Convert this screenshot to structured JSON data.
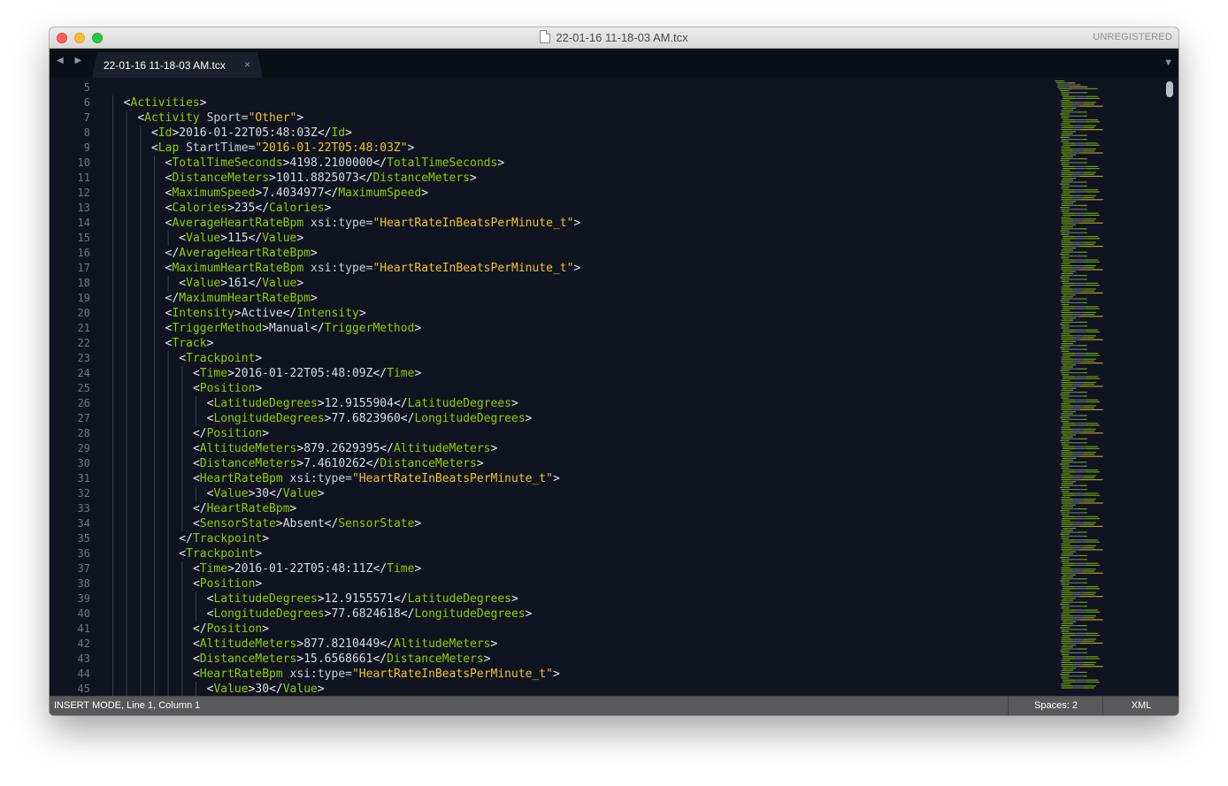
{
  "window": {
    "title": "22-01-16 11-18-03 AM.tcx",
    "unregistered": "UNREGISTERED"
  },
  "tabs": [
    {
      "label": "22-01-16 11-18-03 AM.tcx",
      "close": "×",
      "active": true
    }
  ],
  "navigation": {
    "arrows": "◀ ▶",
    "dropdown": "▼"
  },
  "editor": {
    "first_line_number": 5,
    "lines": [
      [],
      [
        [
          "p",
          "<"
        ],
        [
          "t",
          "Activities"
        ],
        [
          "p",
          ">"
        ]
      ],
      [
        [
          "p",
          "<"
        ],
        [
          "t",
          "Activity"
        ],
        [
          "a",
          " Sport="
        ],
        [
          "s",
          "\"Other\""
        ],
        [
          "p",
          ">"
        ]
      ],
      [
        [
          "p",
          "<"
        ],
        [
          "t",
          "Id"
        ],
        [
          "p",
          ">"
        ],
        [
          "x",
          "2016-01-22T05:48:03Z"
        ],
        [
          "p",
          "</"
        ],
        [
          "t",
          "Id"
        ],
        [
          "p",
          ">"
        ]
      ],
      [
        [
          "p",
          "<"
        ],
        [
          "t",
          "Lap"
        ],
        [
          "a",
          " StartTime="
        ],
        [
          "s",
          "\"2016-01-22T05:48:03Z\""
        ],
        [
          "p",
          ">"
        ]
      ],
      [
        [
          "p",
          "<"
        ],
        [
          "t",
          "TotalTimeSeconds"
        ],
        [
          "p",
          ">"
        ],
        [
          "x",
          "4198.2100000"
        ],
        [
          "p",
          "</"
        ],
        [
          "t",
          "TotalTimeSeconds"
        ],
        [
          "p",
          ">"
        ]
      ],
      [
        [
          "p",
          "<"
        ],
        [
          "t",
          "DistanceMeters"
        ],
        [
          "p",
          ">"
        ],
        [
          "x",
          "1011.8825073"
        ],
        [
          "p",
          "</"
        ],
        [
          "t",
          "DistanceMeters"
        ],
        [
          "p",
          ">"
        ]
      ],
      [
        [
          "p",
          "<"
        ],
        [
          "t",
          "MaximumSpeed"
        ],
        [
          "p",
          ">"
        ],
        [
          "x",
          "7.4034977"
        ],
        [
          "p",
          "</"
        ],
        [
          "t",
          "MaximumSpeed"
        ],
        [
          "p",
          ">"
        ]
      ],
      [
        [
          "p",
          "<"
        ],
        [
          "t",
          "Calories"
        ],
        [
          "p",
          ">"
        ],
        [
          "x",
          "235"
        ],
        [
          "p",
          "</"
        ],
        [
          "t",
          "Calories"
        ],
        [
          "p",
          ">"
        ]
      ],
      [
        [
          "p",
          "<"
        ],
        [
          "t",
          "AverageHeartRateBpm"
        ],
        [
          "a",
          " xsi:type="
        ],
        [
          "s",
          "\"HeartRateInBeatsPerMinute_t\""
        ],
        [
          "p",
          ">"
        ]
      ],
      [
        [
          "p",
          "<"
        ],
        [
          "t",
          "Value"
        ],
        [
          "p",
          ">"
        ],
        [
          "x",
          "115"
        ],
        [
          "p",
          "</"
        ],
        [
          "t",
          "Value"
        ],
        [
          "p",
          ">"
        ]
      ],
      [
        [
          "p",
          "</"
        ],
        [
          "t",
          "AverageHeartRateBpm"
        ],
        [
          "p",
          ">"
        ]
      ],
      [
        [
          "p",
          "<"
        ],
        [
          "t",
          "MaximumHeartRateBpm"
        ],
        [
          "a",
          " xsi:type="
        ],
        [
          "s",
          "\"HeartRateInBeatsPerMinute_t\""
        ],
        [
          "p",
          ">"
        ]
      ],
      [
        [
          "p",
          "<"
        ],
        [
          "t",
          "Value"
        ],
        [
          "p",
          ">"
        ],
        [
          "x",
          "161"
        ],
        [
          "p",
          "</"
        ],
        [
          "t",
          "Value"
        ],
        [
          "p",
          ">"
        ]
      ],
      [
        [
          "p",
          "</"
        ],
        [
          "t",
          "MaximumHeartRateBpm"
        ],
        [
          "p",
          ">"
        ]
      ],
      [
        [
          "p",
          "<"
        ],
        [
          "t",
          "Intensity"
        ],
        [
          "p",
          ">"
        ],
        [
          "x",
          "Active"
        ],
        [
          "p",
          "</"
        ],
        [
          "t",
          "Intensity"
        ],
        [
          "p",
          ">"
        ]
      ],
      [
        [
          "p",
          "<"
        ],
        [
          "t",
          "TriggerMethod"
        ],
        [
          "p",
          ">"
        ],
        [
          "x",
          "Manual"
        ],
        [
          "p",
          "</"
        ],
        [
          "t",
          "TriggerMethod"
        ],
        [
          "p",
          ">"
        ]
      ],
      [
        [
          "p",
          "<"
        ],
        [
          "t",
          "Track"
        ],
        [
          "p",
          ">"
        ]
      ],
      [
        [
          "p",
          "<"
        ],
        [
          "t",
          "Trackpoint"
        ],
        [
          "p",
          ">"
        ]
      ],
      [
        [
          "p",
          "<"
        ],
        [
          "t",
          "Time"
        ],
        [
          "p",
          ">"
        ],
        [
          "x",
          "2016-01-22T05:48:09Z"
        ],
        [
          "p",
          "</"
        ],
        [
          "t",
          "Time"
        ],
        [
          "p",
          ">"
        ]
      ],
      [
        [
          "p",
          "<"
        ],
        [
          "t",
          "Position"
        ],
        [
          "p",
          ">"
        ]
      ],
      [
        [
          "p",
          "<"
        ],
        [
          "t",
          "LatitudeDegrees"
        ],
        [
          "p",
          ">"
        ],
        [
          "x",
          "12.9155904"
        ],
        [
          "p",
          "</"
        ],
        [
          "t",
          "LatitudeDegrees"
        ],
        [
          "p",
          ">"
        ]
      ],
      [
        [
          "p",
          "<"
        ],
        [
          "t",
          "LongitudeDegrees"
        ],
        [
          "p",
          ">"
        ],
        [
          "x",
          "77.6823960"
        ],
        [
          "p",
          "</"
        ],
        [
          "t",
          "LongitudeDegrees"
        ],
        [
          "p",
          ">"
        ]
      ],
      [
        [
          "p",
          "</"
        ],
        [
          "t",
          "Position"
        ],
        [
          "p",
          ">"
        ]
      ],
      [
        [
          "p",
          "<"
        ],
        [
          "t",
          "AltitudeMeters"
        ],
        [
          "p",
          ">"
        ],
        [
          "x",
          "879.2629395"
        ],
        [
          "p",
          "</"
        ],
        [
          "t",
          "AltitudeMeters"
        ],
        [
          "p",
          ">"
        ]
      ],
      [
        [
          "p",
          "<"
        ],
        [
          "t",
          "DistanceMeters"
        ],
        [
          "p",
          ">"
        ],
        [
          "x",
          "7.4610262"
        ],
        [
          "p",
          "</"
        ],
        [
          "t",
          "DistanceMeters"
        ],
        [
          "p",
          ">"
        ]
      ],
      [
        [
          "p",
          "<"
        ],
        [
          "t",
          "HeartRateBpm"
        ],
        [
          "a",
          " xsi:type="
        ],
        [
          "s",
          "\"HeartRateInBeatsPerMinute_t\""
        ],
        [
          "p",
          ">"
        ]
      ],
      [
        [
          "p",
          "<"
        ],
        [
          "t",
          "Value"
        ],
        [
          "p",
          ">"
        ],
        [
          "x",
          "30"
        ],
        [
          "p",
          "</"
        ],
        [
          "t",
          "Value"
        ],
        [
          "p",
          ">"
        ]
      ],
      [
        [
          "p",
          "</"
        ],
        [
          "t",
          "HeartRateBpm"
        ],
        [
          "p",
          ">"
        ]
      ],
      [
        [
          "p",
          "<"
        ],
        [
          "t",
          "SensorState"
        ],
        [
          "p",
          ">"
        ],
        [
          "x",
          "Absent"
        ],
        [
          "p",
          "</"
        ],
        [
          "t",
          "SensorState"
        ],
        [
          "p",
          ">"
        ]
      ],
      [
        [
          "p",
          "</"
        ],
        [
          "t",
          "Trackpoint"
        ],
        [
          "p",
          ">"
        ]
      ],
      [
        [
          "p",
          "<"
        ],
        [
          "t",
          "Trackpoint"
        ],
        [
          "p",
          ">"
        ]
      ],
      [
        [
          "p",
          "<"
        ],
        [
          "t",
          "Time"
        ],
        [
          "p",
          ">"
        ],
        [
          "x",
          "2016-01-22T05:48:11Z"
        ],
        [
          "p",
          "</"
        ],
        [
          "t",
          "Time"
        ],
        [
          "p",
          ">"
        ]
      ],
      [
        [
          "p",
          "<"
        ],
        [
          "t",
          "Position"
        ],
        [
          "p",
          ">"
        ]
      ],
      [
        [
          "p",
          "<"
        ],
        [
          "t",
          "LatitudeDegrees"
        ],
        [
          "p",
          ">"
        ],
        [
          "x",
          "12.9155571"
        ],
        [
          "p",
          "</"
        ],
        [
          "t",
          "LatitudeDegrees"
        ],
        [
          "p",
          ">"
        ]
      ],
      [
        [
          "p",
          "<"
        ],
        [
          "t",
          "LongitudeDegrees"
        ],
        [
          "p",
          ">"
        ],
        [
          "x",
          "77.6824618"
        ],
        [
          "p",
          "</"
        ],
        [
          "t",
          "LongitudeDegrees"
        ],
        [
          "p",
          ">"
        ]
      ],
      [
        [
          "p",
          "</"
        ],
        [
          "t",
          "Position"
        ],
        [
          "p",
          ">"
        ]
      ],
      [
        [
          "p",
          "<"
        ],
        [
          "t",
          "AltitudeMeters"
        ],
        [
          "p",
          ">"
        ],
        [
          "x",
          "877.8210449"
        ],
        [
          "p",
          "</"
        ],
        [
          "t",
          "AltitudeMeters"
        ],
        [
          "p",
          ">"
        ]
      ],
      [
        [
          "p",
          "<"
        ],
        [
          "t",
          "DistanceMeters"
        ],
        [
          "p",
          ">"
        ],
        [
          "x",
          "15.6568661"
        ],
        [
          "p",
          "</"
        ],
        [
          "t",
          "DistanceMeters"
        ],
        [
          "p",
          ">"
        ]
      ],
      [
        [
          "p",
          "<"
        ],
        [
          "t",
          "HeartRateBpm"
        ],
        [
          "a",
          " xsi:type="
        ],
        [
          "s",
          "\"HeartRateInBeatsPerMinute_t\""
        ],
        [
          "p",
          ">"
        ]
      ],
      [
        [
          "p",
          "<"
        ],
        [
          "t",
          "Value"
        ],
        [
          "p",
          ">"
        ],
        [
          "x",
          "30"
        ],
        [
          "p",
          "</"
        ],
        [
          "t",
          "Value"
        ],
        [
          "p",
          ">"
        ]
      ]
    ],
    "indents": [
      0,
      1,
      2,
      3,
      3,
      4,
      4,
      4,
      4,
      4,
      5,
      4,
      4,
      5,
      4,
      4,
      4,
      4,
      5,
      6,
      6,
      7,
      7,
      6,
      6,
      6,
      6,
      7,
      6,
      6,
      5,
      5,
      6,
      6,
      7,
      7,
      6,
      6,
      6,
      6,
      7
    ],
    "colors": {
      "background": "#0f1420",
      "tag": "#8fce00",
      "string": "#f2c230",
      "attribute": "#c9ced6",
      "text": "#d7dce3",
      "line_number": "#6d7686"
    }
  },
  "status": {
    "left": "INSERT MODE, Line 1, Column 1",
    "spaces": "Spaces: 2",
    "syntax": "XML"
  }
}
